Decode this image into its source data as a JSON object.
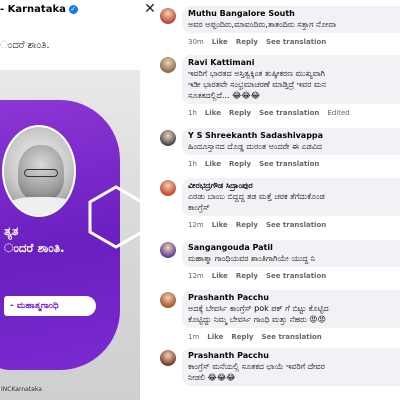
{
  "post": {
    "page_name": "- Karnataka",
    "verified_icon": "verified-check-icon",
    "caption": "ಂದರೆ ಶಾಂತಿ.",
    "quote_line1": "ತ್ಯತ",
    "quote_line2": "ಂದರೆ ಶಾಂತಿ.",
    "author_label": "- ಮಹಾತ್ಮಗಾಂಧಿ",
    "watermark": "INCKarnataka",
    "close_icon": "close-icon",
    "accent_purple": "#7b2bd0"
  },
  "comments": [
    {
      "author": "Muthu Bangalore South",
      "lines": [
        "ಅವರ ಅಪ್ಪಂದಿರು,ಮಾವಂದಿರು,ತಾತಂದಿರು ಸತ್ತಾಗ ನೋವಾ"
      ],
      "time": "30m",
      "actions": [
        "Like",
        "Reply",
        "See translation"
      ],
      "edited": "",
      "avatar_icon": "user-avatar-icon"
    },
    {
      "author": "Ravi Kattimani",
      "lines": [
        "ಇವರಿಗೆ ಭಾರತದ ಅಸ್ತಿತ್ವಕ್ಕಿಂತ ತುಷ್ಠೀಕರಣ ಮುಖ್ಯವಾಗಿ",
        "ಇಡೀ ಭಾರತವೇ ಸಂಭ್ರಮಾಚರಣೆ ಮಾಡ್ತಿದ್ರೆ ಇವರ ಮನ",
        "ಸೂತಕದಲ್ಲಿದೆ... 😂😂😂"
      ],
      "time": "1h",
      "actions": [
        "Like",
        "Reply",
        "See translation"
      ],
      "edited": "Edited",
      "avatar_icon": "user-avatar-icon"
    },
    {
      "author": "Y S Shreekanth Sadashivappa",
      "lines": [
        "ಹಿಂದೂಸ್ತಾನದ ದೊಡ್ಡ ದುರಂತ ಅಂದರೇ ಈ ಎಡವಿದ"
      ],
      "time": "1h",
      "actions": [
        "Like",
        "Reply",
        "See translation"
      ],
      "edited": "",
      "avatar_icon": "user-avatar-icon"
    },
    {
      "author": "ವೀರಭದ್ರಗೌಡ ಸಿದ್ರಾಂಪುರ",
      "lines": [
        "ಎರಡು ಬಾಂಬ ಬಿದ್ದದ್ದ ತಡ ಮತ್ತೆ ಚರಕ ತೆಗೆದುಕೊಂಡ",
        "ಕಾಂಗ್ರೆಸ್"
      ],
      "time": "12m",
      "actions": [
        "Like",
        "Reply",
        "See translation"
      ],
      "edited": "",
      "avatar_icon": "user-avatar-icon"
    },
    {
      "author": "Sangangouda Patil",
      "lines": [
        "ಮಹಾತ್ಮಾ ಗಾಂಧಿಯವರ ಶಾಂತಿಗಾಗಿಯೇ ಯುದ್ಧ ನಿ"
      ],
      "time": "12m",
      "actions": [
        "Like",
        "Reply",
        "See translation"
      ],
      "edited": "",
      "avatar_icon": "user-avatar-icon"
    },
    {
      "author": "Prashanth Pacchu",
      "lines": [
        "ಅದಕ್ಕೆ ಬೇವರ್ಸಿ ಕಾಂಗ್ರೆಸ್ pok ಪಕ್ ಗೆ ಬಿಟ್ಟು ಕೊಟ್ಟಿದ",
        "ಕೊಟ್ಟಿದ್ದು ನಿಮ್ಮ ಬೇವರ್ಸಿ ಗಾಂಧಿ ಮತ್ತು ನೆಹರು 😡😡"
      ],
      "time": "1m",
      "actions": [
        "Like",
        "Reply",
        "See translation"
      ],
      "edited": "",
      "avatar_icon": "user-avatar-icon"
    },
    {
      "author": "Prashanth Pacchu",
      "lines": [
        "ಕಾಂಗ್ರೆಸ್ ಮನೆಯಲ್ಲಿ ಸೂತಕದ ಛಾಯೆ ಇವರಿಗೆ ದೇವರ",
        "ನೀಡಲಿ 😂😂😂"
      ],
      "time": "",
      "actions": [],
      "edited": "",
      "avatar_icon": "user-avatar-icon"
    }
  ]
}
